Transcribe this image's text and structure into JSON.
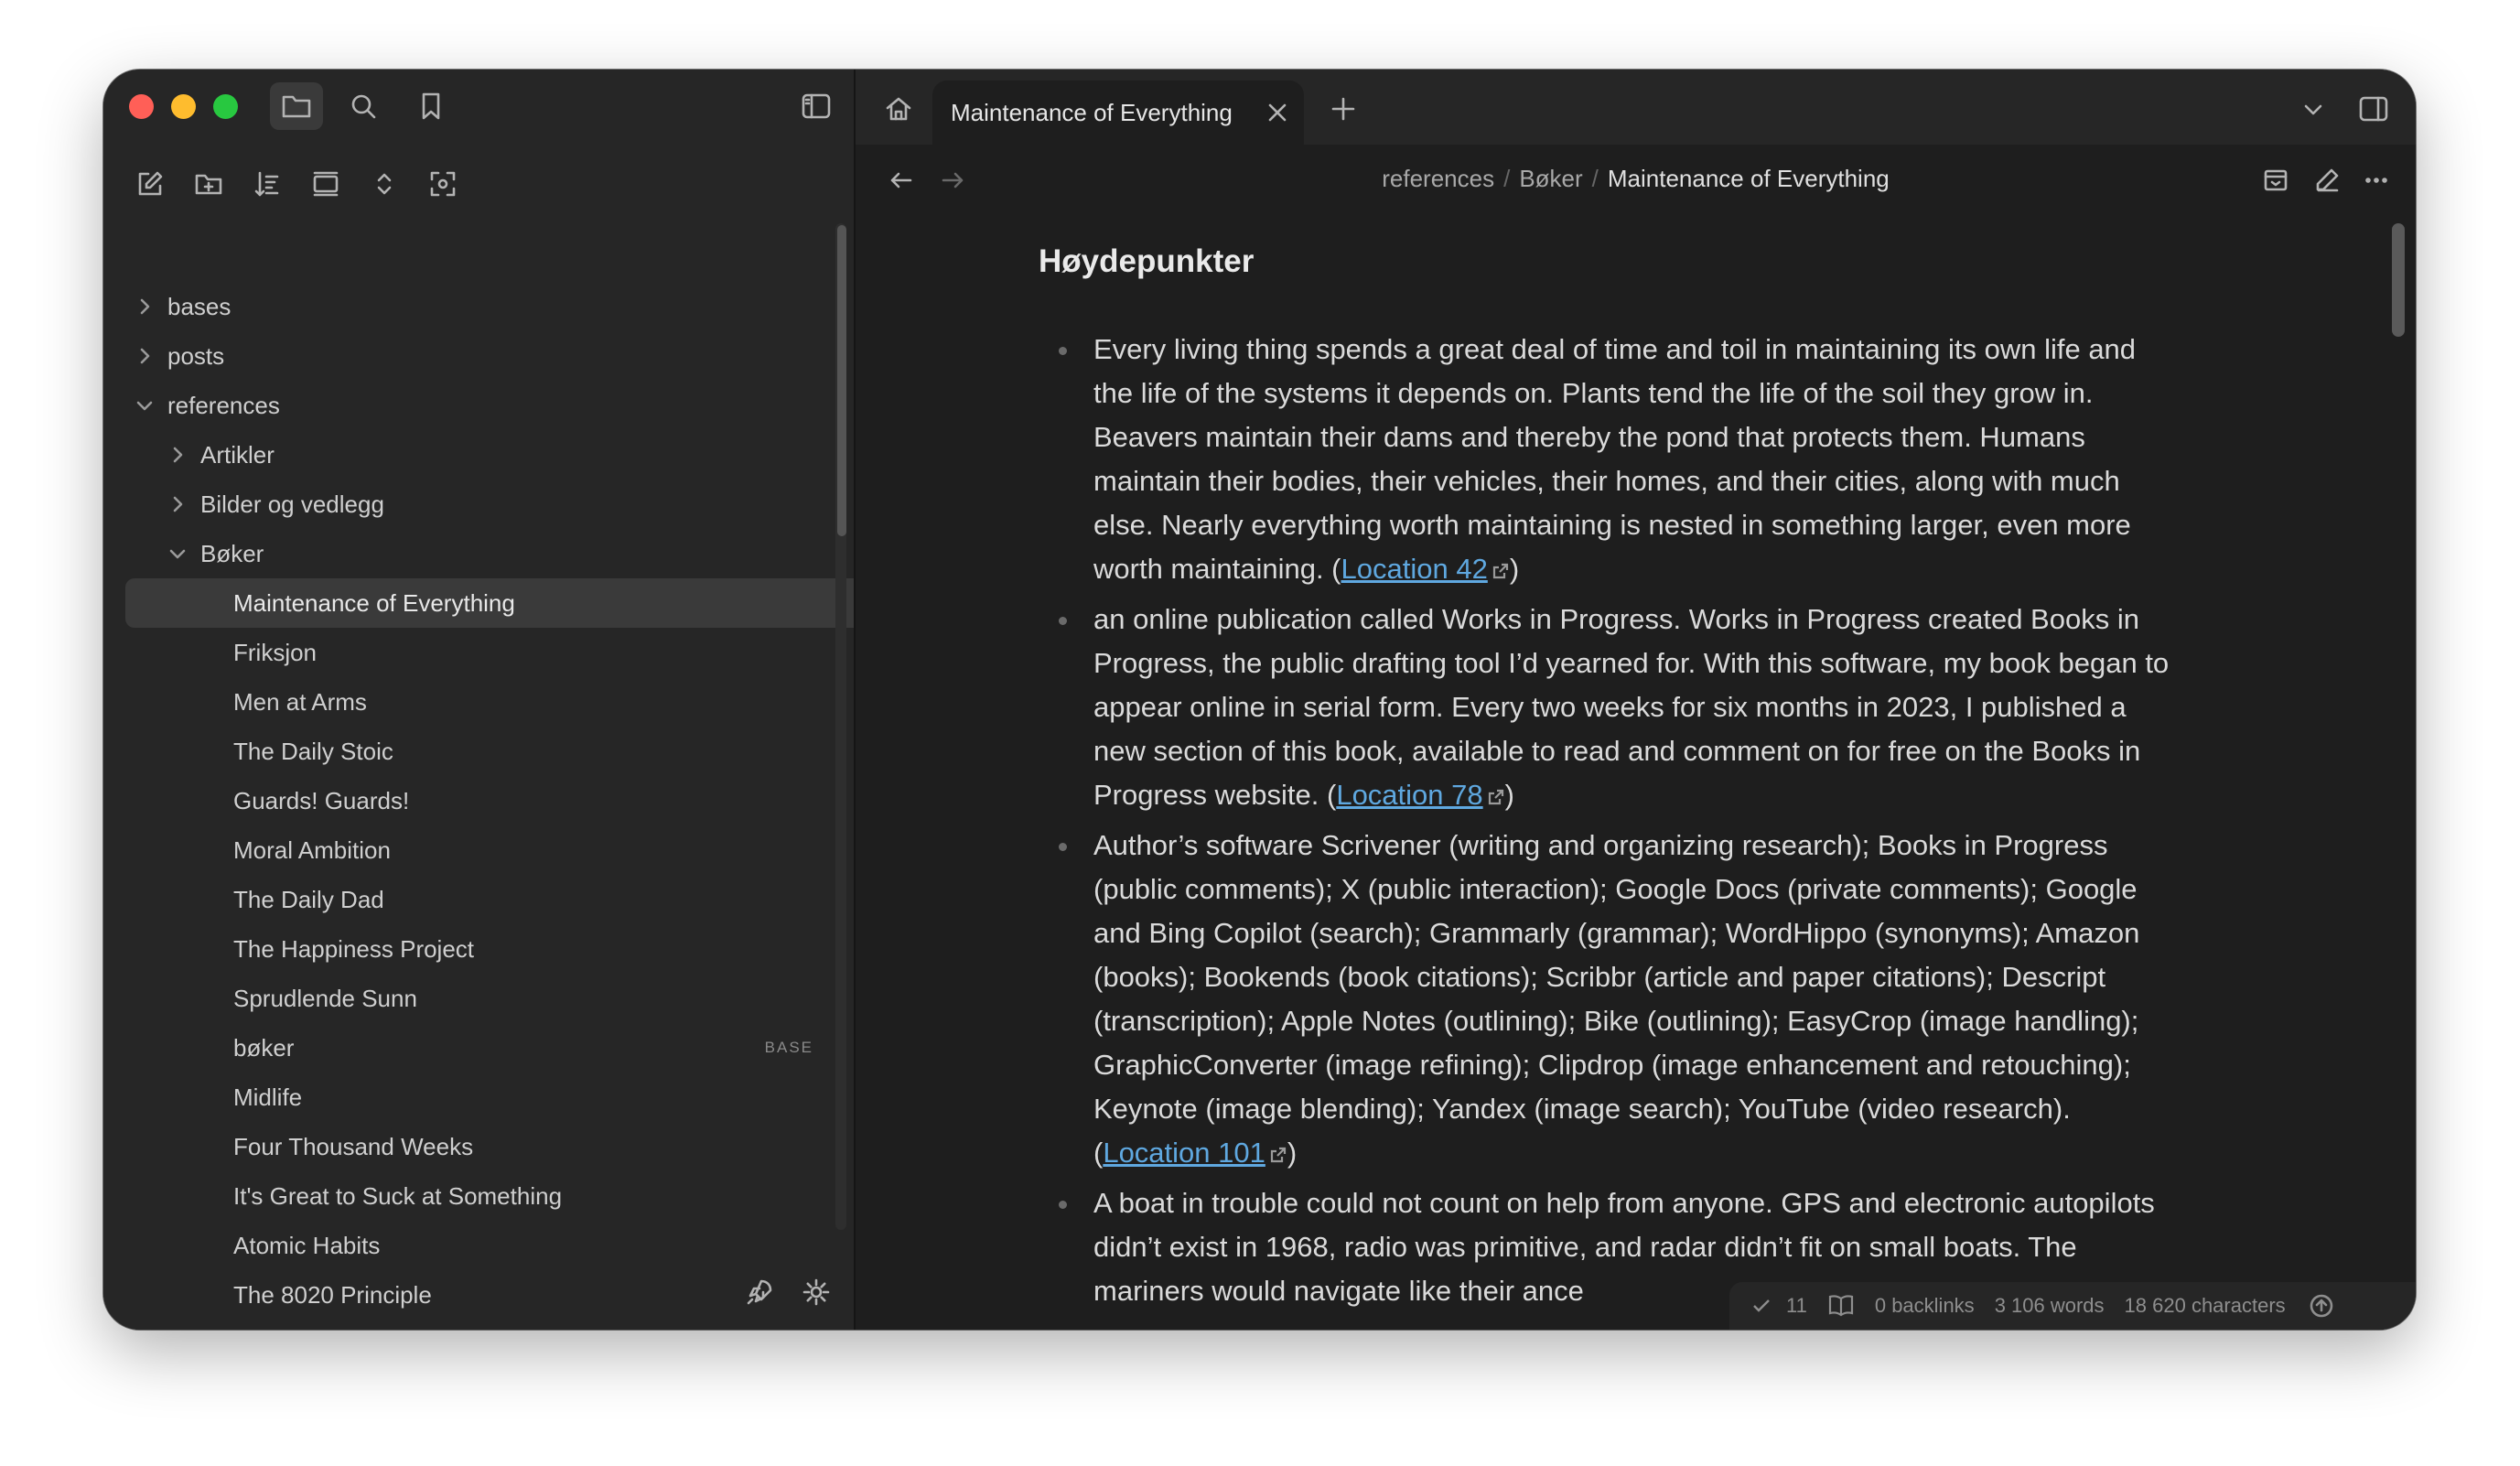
{
  "sidebar": {
    "tree": [
      {
        "label": "bases",
        "level": 0,
        "chevron": "right"
      },
      {
        "label": "posts",
        "level": 0,
        "chevron": "right"
      },
      {
        "label": "references",
        "level": 0,
        "chevron": "down"
      },
      {
        "label": "Artikler",
        "level": 1,
        "chevron": "right"
      },
      {
        "label": "Bilder og vedlegg",
        "level": 1,
        "chevron": "right"
      },
      {
        "label": "Bøker",
        "level": 1,
        "chevron": "down"
      },
      {
        "label": "Maintenance of Everything",
        "level": 2,
        "selected": true
      },
      {
        "label": "Friksjon",
        "level": 2
      },
      {
        "label": "Men at Arms",
        "level": 2
      },
      {
        "label": "The Daily Stoic",
        "level": 2
      },
      {
        "label": "Guards! Guards!",
        "level": 2
      },
      {
        "label": "Moral Ambition",
        "level": 2
      },
      {
        "label": "The Daily Dad",
        "level": 2
      },
      {
        "label": "The Happiness Project",
        "level": 2
      },
      {
        "label": "Sprudlende Sunn",
        "level": 2
      },
      {
        "label": "bøker",
        "level": 2,
        "tag": "BASE"
      },
      {
        "label": "Midlife",
        "level": 2
      },
      {
        "label": "Four Thousand Weeks",
        "level": 2
      },
      {
        "label": "It's Great to Suck at Something",
        "level": 2
      },
      {
        "label": "Atomic Habits",
        "level": 2
      },
      {
        "label": "The 8020 Principle",
        "level": 2
      }
    ]
  },
  "tab": {
    "title": "Maintenance of Everything"
  },
  "breadcrumb": {
    "part1": "references",
    "part2": "Bøker",
    "current": "Maintenance of Everything",
    "sep": "/"
  },
  "note": {
    "heading": "Høydepunkter",
    "bullets": [
      {
        "text": "Every living thing spends a great deal of time and toil in maintaining its own life and the life of the systems it depends on. Plants tend the life of the soil they grow in. Beavers maintain their dams and thereby the pond that protects them. Humans maintain their bodies, their vehicles, their homes, and their cities, along with much else. Nearly everything worth maintaining is nested in something larger, even more worth maintaining. (",
        "link": "Location 42",
        "after": ")"
      },
      {
        "text": "an online publication called Works in Progress. Works in Progress created Books in Progress, the public drafting tool I’d yearned for. With this software, my book began to appear online in serial form. Every two weeks for six months in 2023, I published a new section of this book, available to read and comment on for free on the Books in Progress website. (",
        "link": "Location 78",
        "after": ")"
      },
      {
        "text": "Author’s software Scrivener (writing and organizing research); Books in Progress (public comments); X (public interaction); Google Docs (private comments); Google and Bing Copilot (search); Grammarly (grammar); WordHippo (synonyms); Amazon (books); Bookends (book citations); Scribbr (article and paper citations); Descript (transcription); Apple Notes (outlining); Bike (outlining); EasyCrop (image handling); GraphicConverter (image refining); Clipdrop (image enhancement and retouching); Keynote (image blending); Yandex (image search); YouTube (video research). (",
        "link": "Location 101",
        "after": ")"
      },
      {
        "text": "A boat in trouble could not count on help from anyone. GPS and electronic autopilots didn’t exist in 1968, radio was primitive, and radar didn’t fit on small boats. The mariners would navigate like their ance",
        "link": "",
        "after": ""
      }
    ]
  },
  "status": {
    "tasks": "11",
    "backlinks": "0 backlinks",
    "words": "3 106 words",
    "characters": "18 620 characters"
  },
  "colors": {
    "background": "#1e1e1e",
    "sidebar": "#262626",
    "link": "#5fa8e0",
    "selected": "#3a3a3a"
  }
}
